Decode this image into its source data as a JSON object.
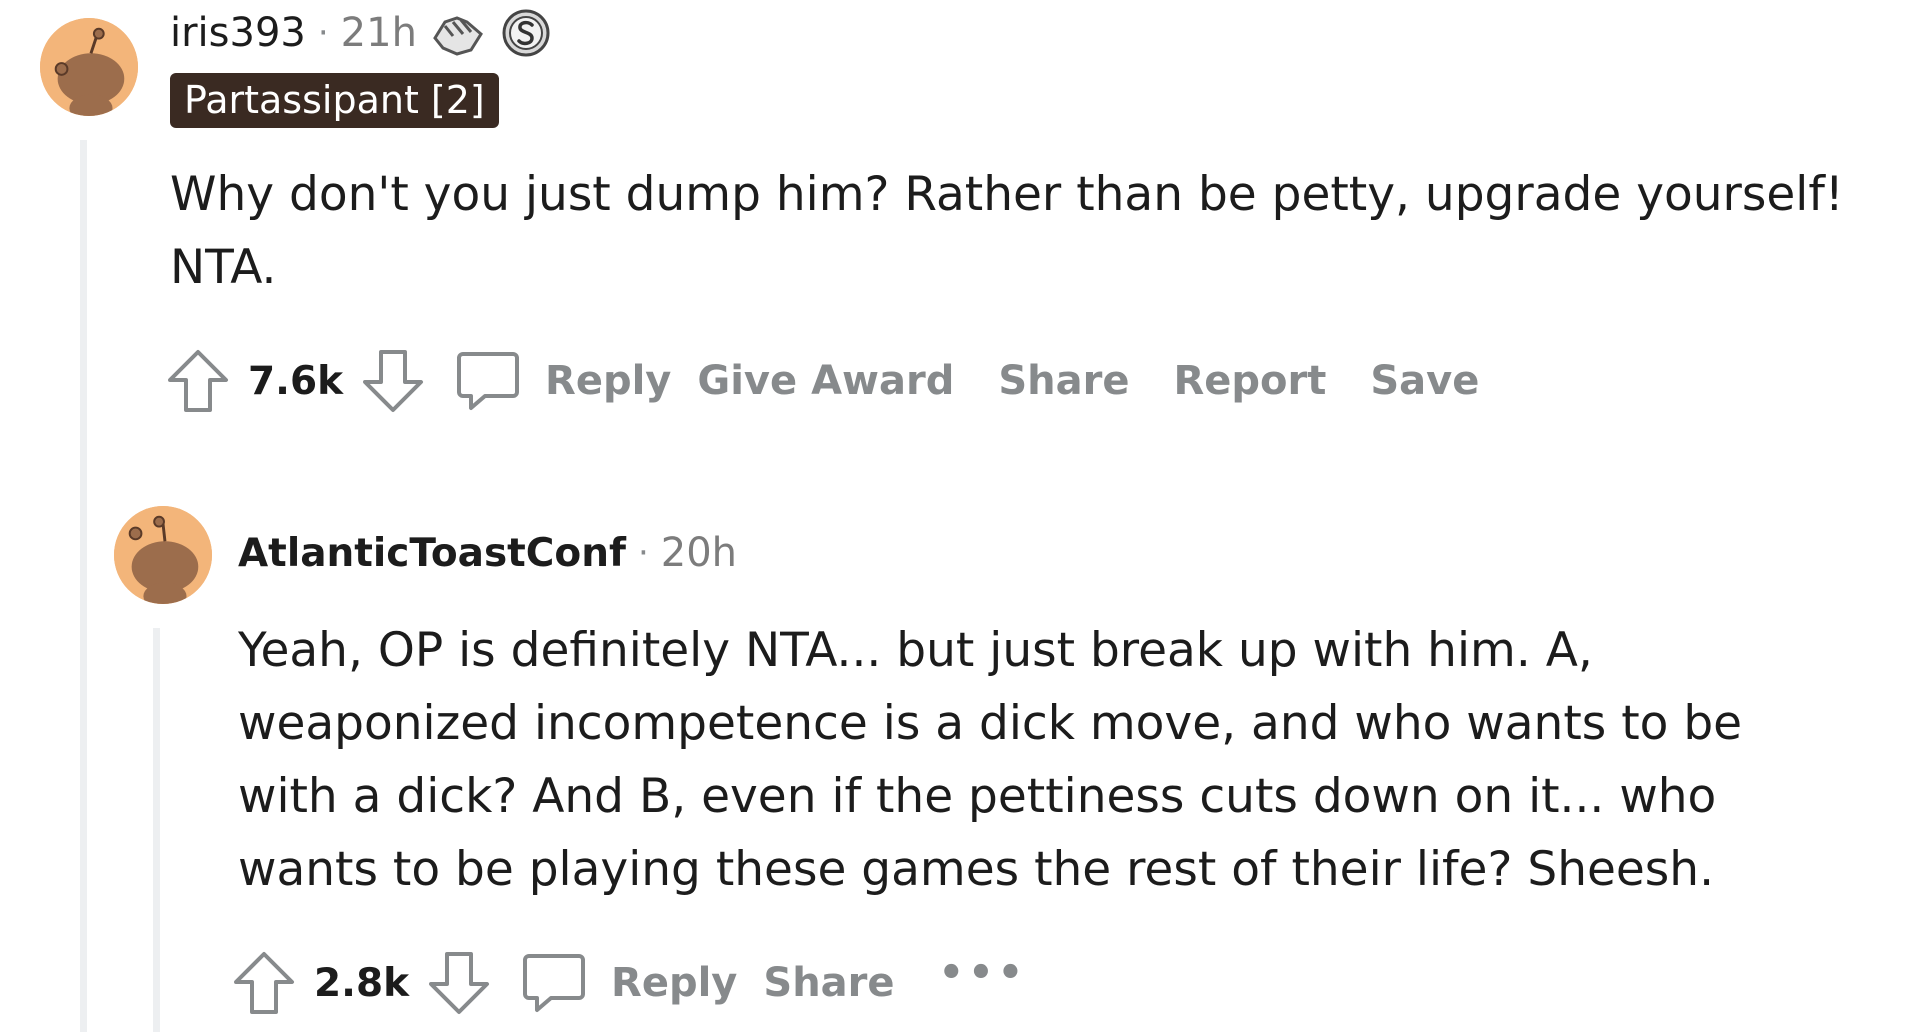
{
  "comments": [
    {
      "username": "iris393",
      "separator": "·",
      "time": "21h",
      "awards": [
        "handshake-award-icon",
        "silver-s-award-icon"
      ],
      "flair": "Partassipant [2]",
      "body": "Why don't you just dump him? Rather than be petty, upgrade yourself! NTA.",
      "score": "7.6k",
      "actions": {
        "reply": "Reply",
        "give_award": "Give Award",
        "share": "Share",
        "report": "Report",
        "save": "Save"
      }
    },
    {
      "username": "AtlanticToastConf",
      "separator": "·",
      "time": "20h",
      "body": "Yeah, OP is definitely NTA... but just break up with him. A, weaponized incompetence is a dick move, and who wants to be with a dick? And B, even if the pettiness cuts down on it... who wants to be playing these games the rest of their life? Sheesh.",
      "score": "2.8k",
      "actions": {
        "reply": "Reply",
        "share": "Share",
        "more": "•••"
      }
    }
  ],
  "colors": {
    "avatar_bg": "#f3b57a",
    "flair_bg": "#3a2a22",
    "muted_text": "#878a8c",
    "thread_line": "#edeff1"
  }
}
